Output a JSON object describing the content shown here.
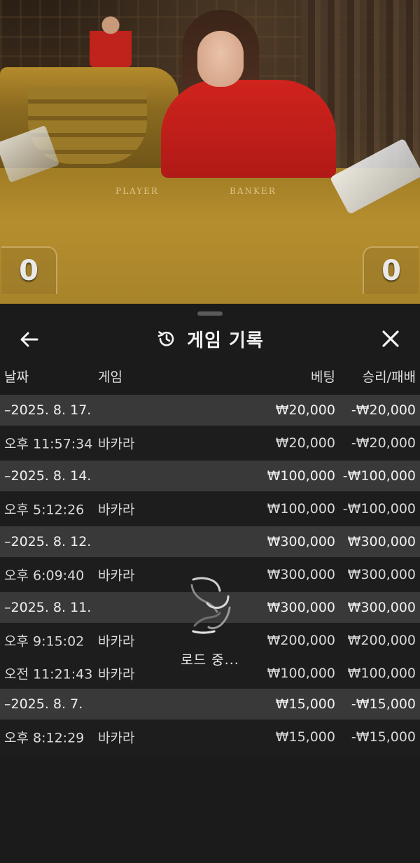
{
  "video": {
    "player_label": "PLAYER",
    "banker_label": "BANKER",
    "player_score": "0",
    "banker_score": "0"
  },
  "sheet": {
    "title": "게임 기록",
    "columns": {
      "date": "날짜",
      "game": "게임",
      "bet": "베팅",
      "result": "승리/패배"
    },
    "loading_text": "로드 중..."
  },
  "history": [
    {
      "type": "date",
      "date": "–2025. 8. 17.",
      "bet": "₩20,000",
      "result": "-₩20,000"
    },
    {
      "type": "item",
      "time": "오후 11:57:34",
      "game": "바카라",
      "bet": "₩20,000",
      "result": "-₩20,000"
    },
    {
      "type": "date",
      "date": "–2025. 8. 14.",
      "bet": "₩100,000",
      "result": "-₩100,000"
    },
    {
      "type": "item",
      "time": "오후 5:12:26",
      "game": "바카라",
      "bet": "₩100,000",
      "result": "-₩100,000"
    },
    {
      "type": "date",
      "date": "–2025. 8. 12.",
      "bet": "₩300,000",
      "result": "₩300,000"
    },
    {
      "type": "item",
      "time": "오후 6:09:40",
      "game": "바카라",
      "bet": "₩300,000",
      "result": "₩300,000"
    },
    {
      "type": "date",
      "date": "–2025. 8. 11.",
      "bet": "₩300,000",
      "result": "₩300,000"
    },
    {
      "type": "item",
      "time": "오후 9:15:02",
      "game": "바카라",
      "bet": "₩200,000",
      "result": "₩200,000"
    },
    {
      "type": "item",
      "time": "오전 11:21:43",
      "game": "바카라",
      "bet": "₩100,000",
      "result": "₩100,000"
    },
    {
      "type": "date",
      "date": "–2025. 8. 7.",
      "bet": "₩15,000",
      "result": "-₩15,000"
    },
    {
      "type": "item",
      "time": "오후 8:12:29",
      "game": "바카라",
      "bet": "₩15,000",
      "result": "-₩15,000"
    }
  ],
  "icons": {
    "back": "arrow-left-icon",
    "history": "history-clock-icon",
    "close": "close-x-icon",
    "loading": "spinner-icon"
  }
}
